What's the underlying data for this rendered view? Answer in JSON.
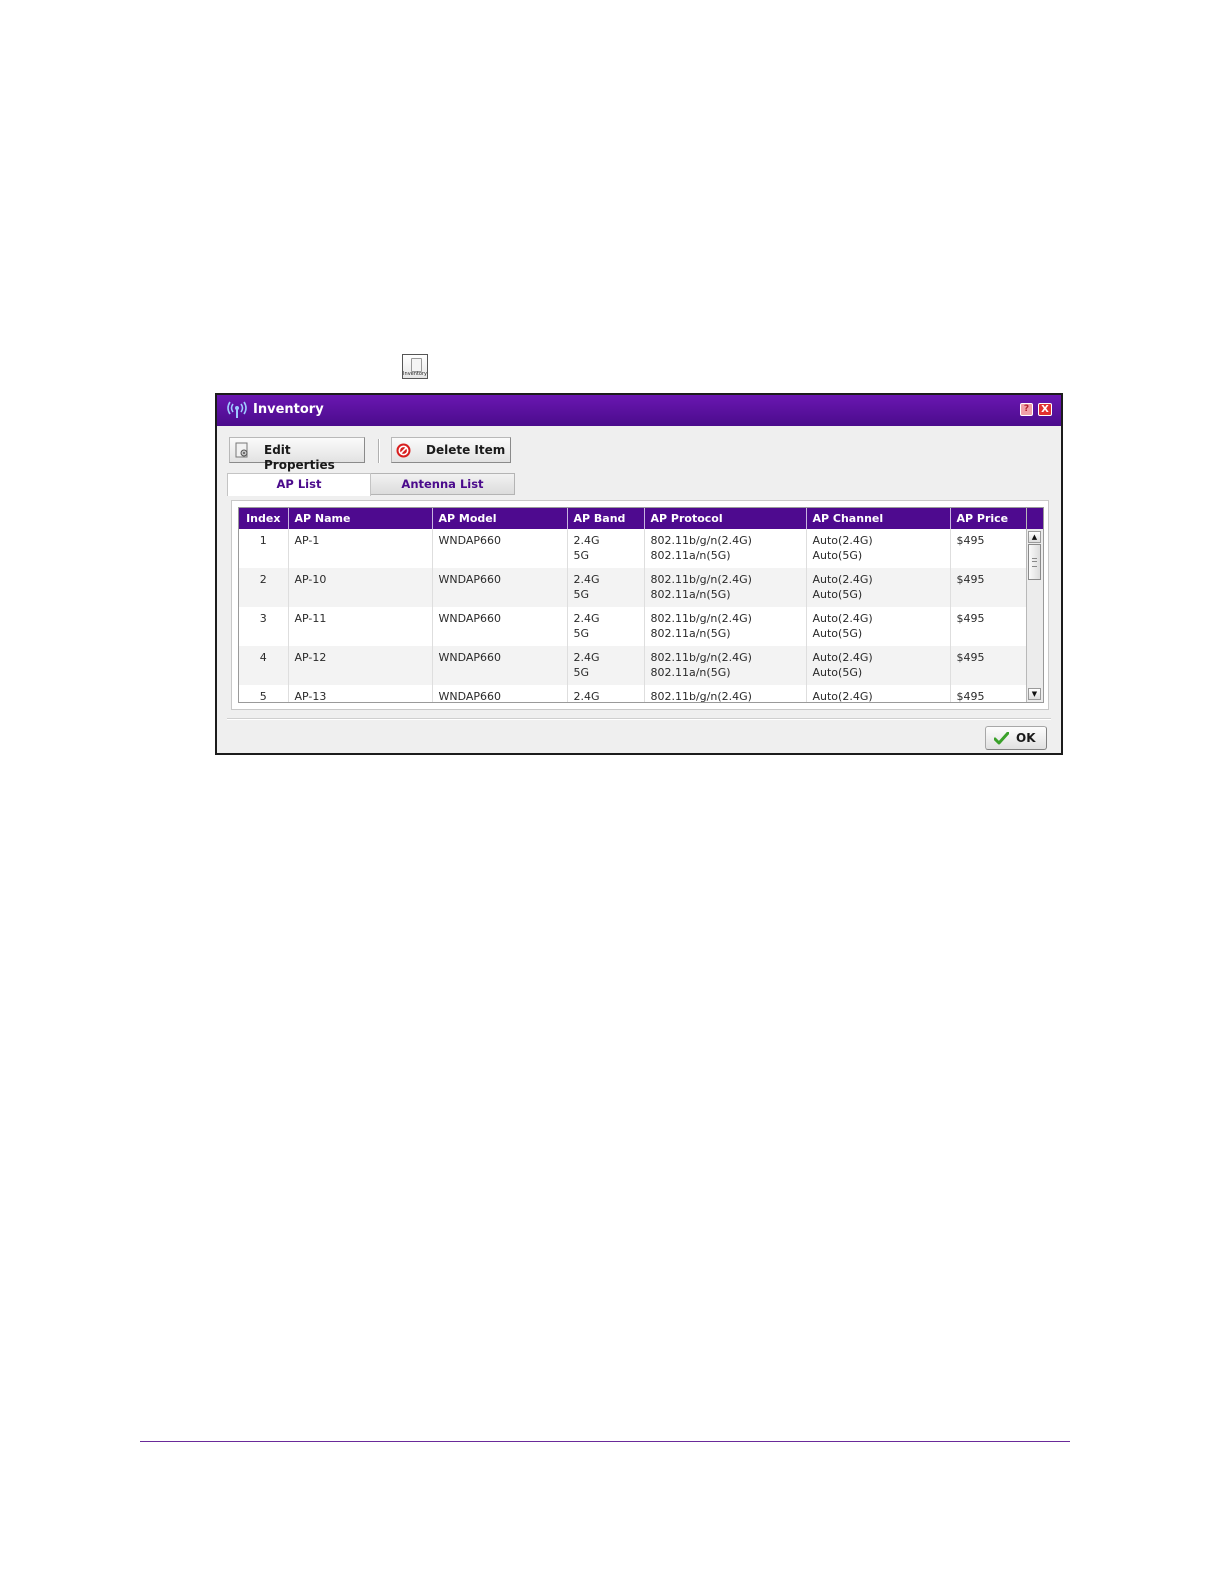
{
  "launcher": {
    "caption": "Inventory"
  },
  "dialog": {
    "title": "Inventory",
    "help_glyph": "?",
    "close_glyph": "X",
    "toolbar": {
      "edit_label": "Edit Properties",
      "delete_label": "Delete Item"
    },
    "tabs": [
      {
        "label": "AP List",
        "active": true
      },
      {
        "label": "Antenna List",
        "active": false
      }
    ],
    "table": {
      "columns": [
        "Index",
        "AP Name",
        "AP Model",
        "AP Band",
        "AP Protocol",
        "AP Channel",
        "AP Price"
      ],
      "rows": [
        {
          "index": "1",
          "name": "AP-1",
          "model": "WNDAP660",
          "band": [
            "2.4G",
            "5G"
          ],
          "protocol": [
            "802.11b/g/n(2.4G)",
            "802.11a/n(5G)"
          ],
          "channel": [
            "Auto(2.4G)",
            "Auto(5G)"
          ],
          "price": "$495"
        },
        {
          "index": "2",
          "name": "AP-10",
          "model": "WNDAP660",
          "band": [
            "2.4G",
            "5G"
          ],
          "protocol": [
            "802.11b/g/n(2.4G)",
            "802.11a/n(5G)"
          ],
          "channel": [
            "Auto(2.4G)",
            "Auto(5G)"
          ],
          "price": "$495"
        },
        {
          "index": "3",
          "name": "AP-11",
          "model": "WNDAP660",
          "band": [
            "2.4G",
            "5G"
          ],
          "protocol": [
            "802.11b/g/n(2.4G)",
            "802.11a/n(5G)"
          ],
          "channel": [
            "Auto(2.4G)",
            "Auto(5G)"
          ],
          "price": "$495"
        },
        {
          "index": "4",
          "name": "AP-12",
          "model": "WNDAP660",
          "band": [
            "2.4G",
            "5G"
          ],
          "protocol": [
            "802.11b/g/n(2.4G)",
            "802.11a/n(5G)"
          ],
          "channel": [
            "Auto(2.4G)",
            "Auto(5G)"
          ],
          "price": "$495"
        },
        {
          "index": "5",
          "name": "AP-13",
          "model": "WNDAP660",
          "band": [
            "2.4G"
          ],
          "protocol": [
            "802.11b/g/n(2.4G)"
          ],
          "channel": [
            "Auto(2.4G)"
          ],
          "price": "$495"
        }
      ]
    },
    "scrollbar": {
      "up_glyph": "▲",
      "down_glyph": "▼"
    },
    "ok_label": "OK"
  },
  "colors": {
    "brand_purple": "#4e0a8f",
    "title_purple": "#6a17b1",
    "page_rule": "#6a2a9a"
  },
  "icons": {
    "launcher": "inventory-icon",
    "title": "wireless-antenna-icon",
    "edit": "edit-properties-icon",
    "delete": "delete-icon",
    "ok": "check-icon"
  }
}
